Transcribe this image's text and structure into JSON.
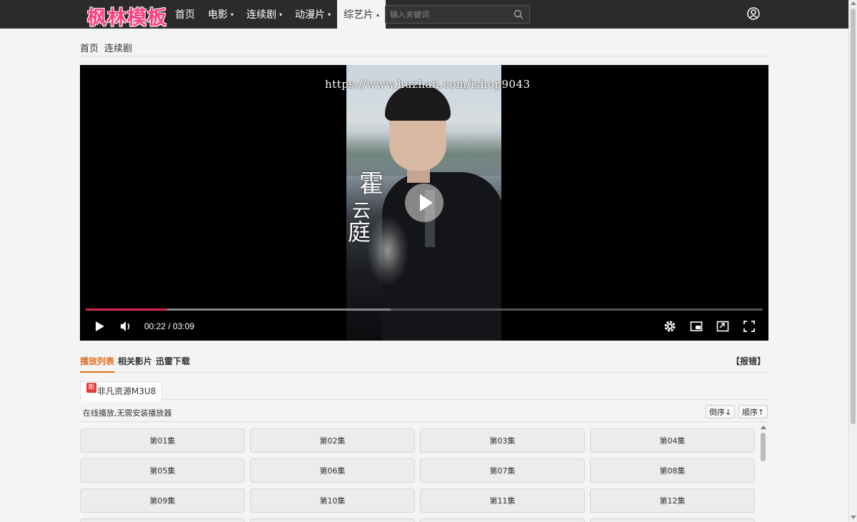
{
  "header": {
    "logo_text": "枫林模板",
    "nav": [
      {
        "label": "首页",
        "caret": "",
        "active": false
      },
      {
        "label": "电影",
        "caret": "▾",
        "active": false
      },
      {
        "label": "连续剧",
        "caret": "▾",
        "active": false
      },
      {
        "label": "动漫片",
        "caret": "▾",
        "active": false
      },
      {
        "label": "综艺片",
        "caret": "▴",
        "active": true
      }
    ],
    "search_placeholder": "输入关键词",
    "search_icon": "search-icon",
    "user_icon": "user-icon"
  },
  "breadcrumb": [
    "首页",
    "连续剧"
  ],
  "player": {
    "watermark": "https://www.huzhan.com/ishop9043",
    "poster_chars": [
      "霍",
      "云",
      "庭"
    ],
    "current_time": "00:22",
    "separator": " / ",
    "duration": "03:09",
    "played_fraction": 0.12,
    "buffered_fraction": 0.45,
    "progress_color": "#d8284a"
  },
  "tabs": {
    "items": [
      "播放列表",
      "相关影片",
      "迅雷下载"
    ],
    "active_index": 0,
    "report_label": "【报错】",
    "accent_color": "#e06b1f"
  },
  "source": {
    "badge": "新",
    "name": "非凡资源M3U8",
    "info": "在线播放,无需安装播放器",
    "sort_desc": "倒序↓",
    "sort_asc": "顺序↑"
  },
  "episodes": [
    "第01集",
    "第02集",
    "第03集",
    "第04集",
    "第05集",
    "第06集",
    "第07集",
    "第08集",
    "第09集",
    "第10集",
    "第11集",
    "第12集",
    "",
    "",
    "",
    ""
  ]
}
